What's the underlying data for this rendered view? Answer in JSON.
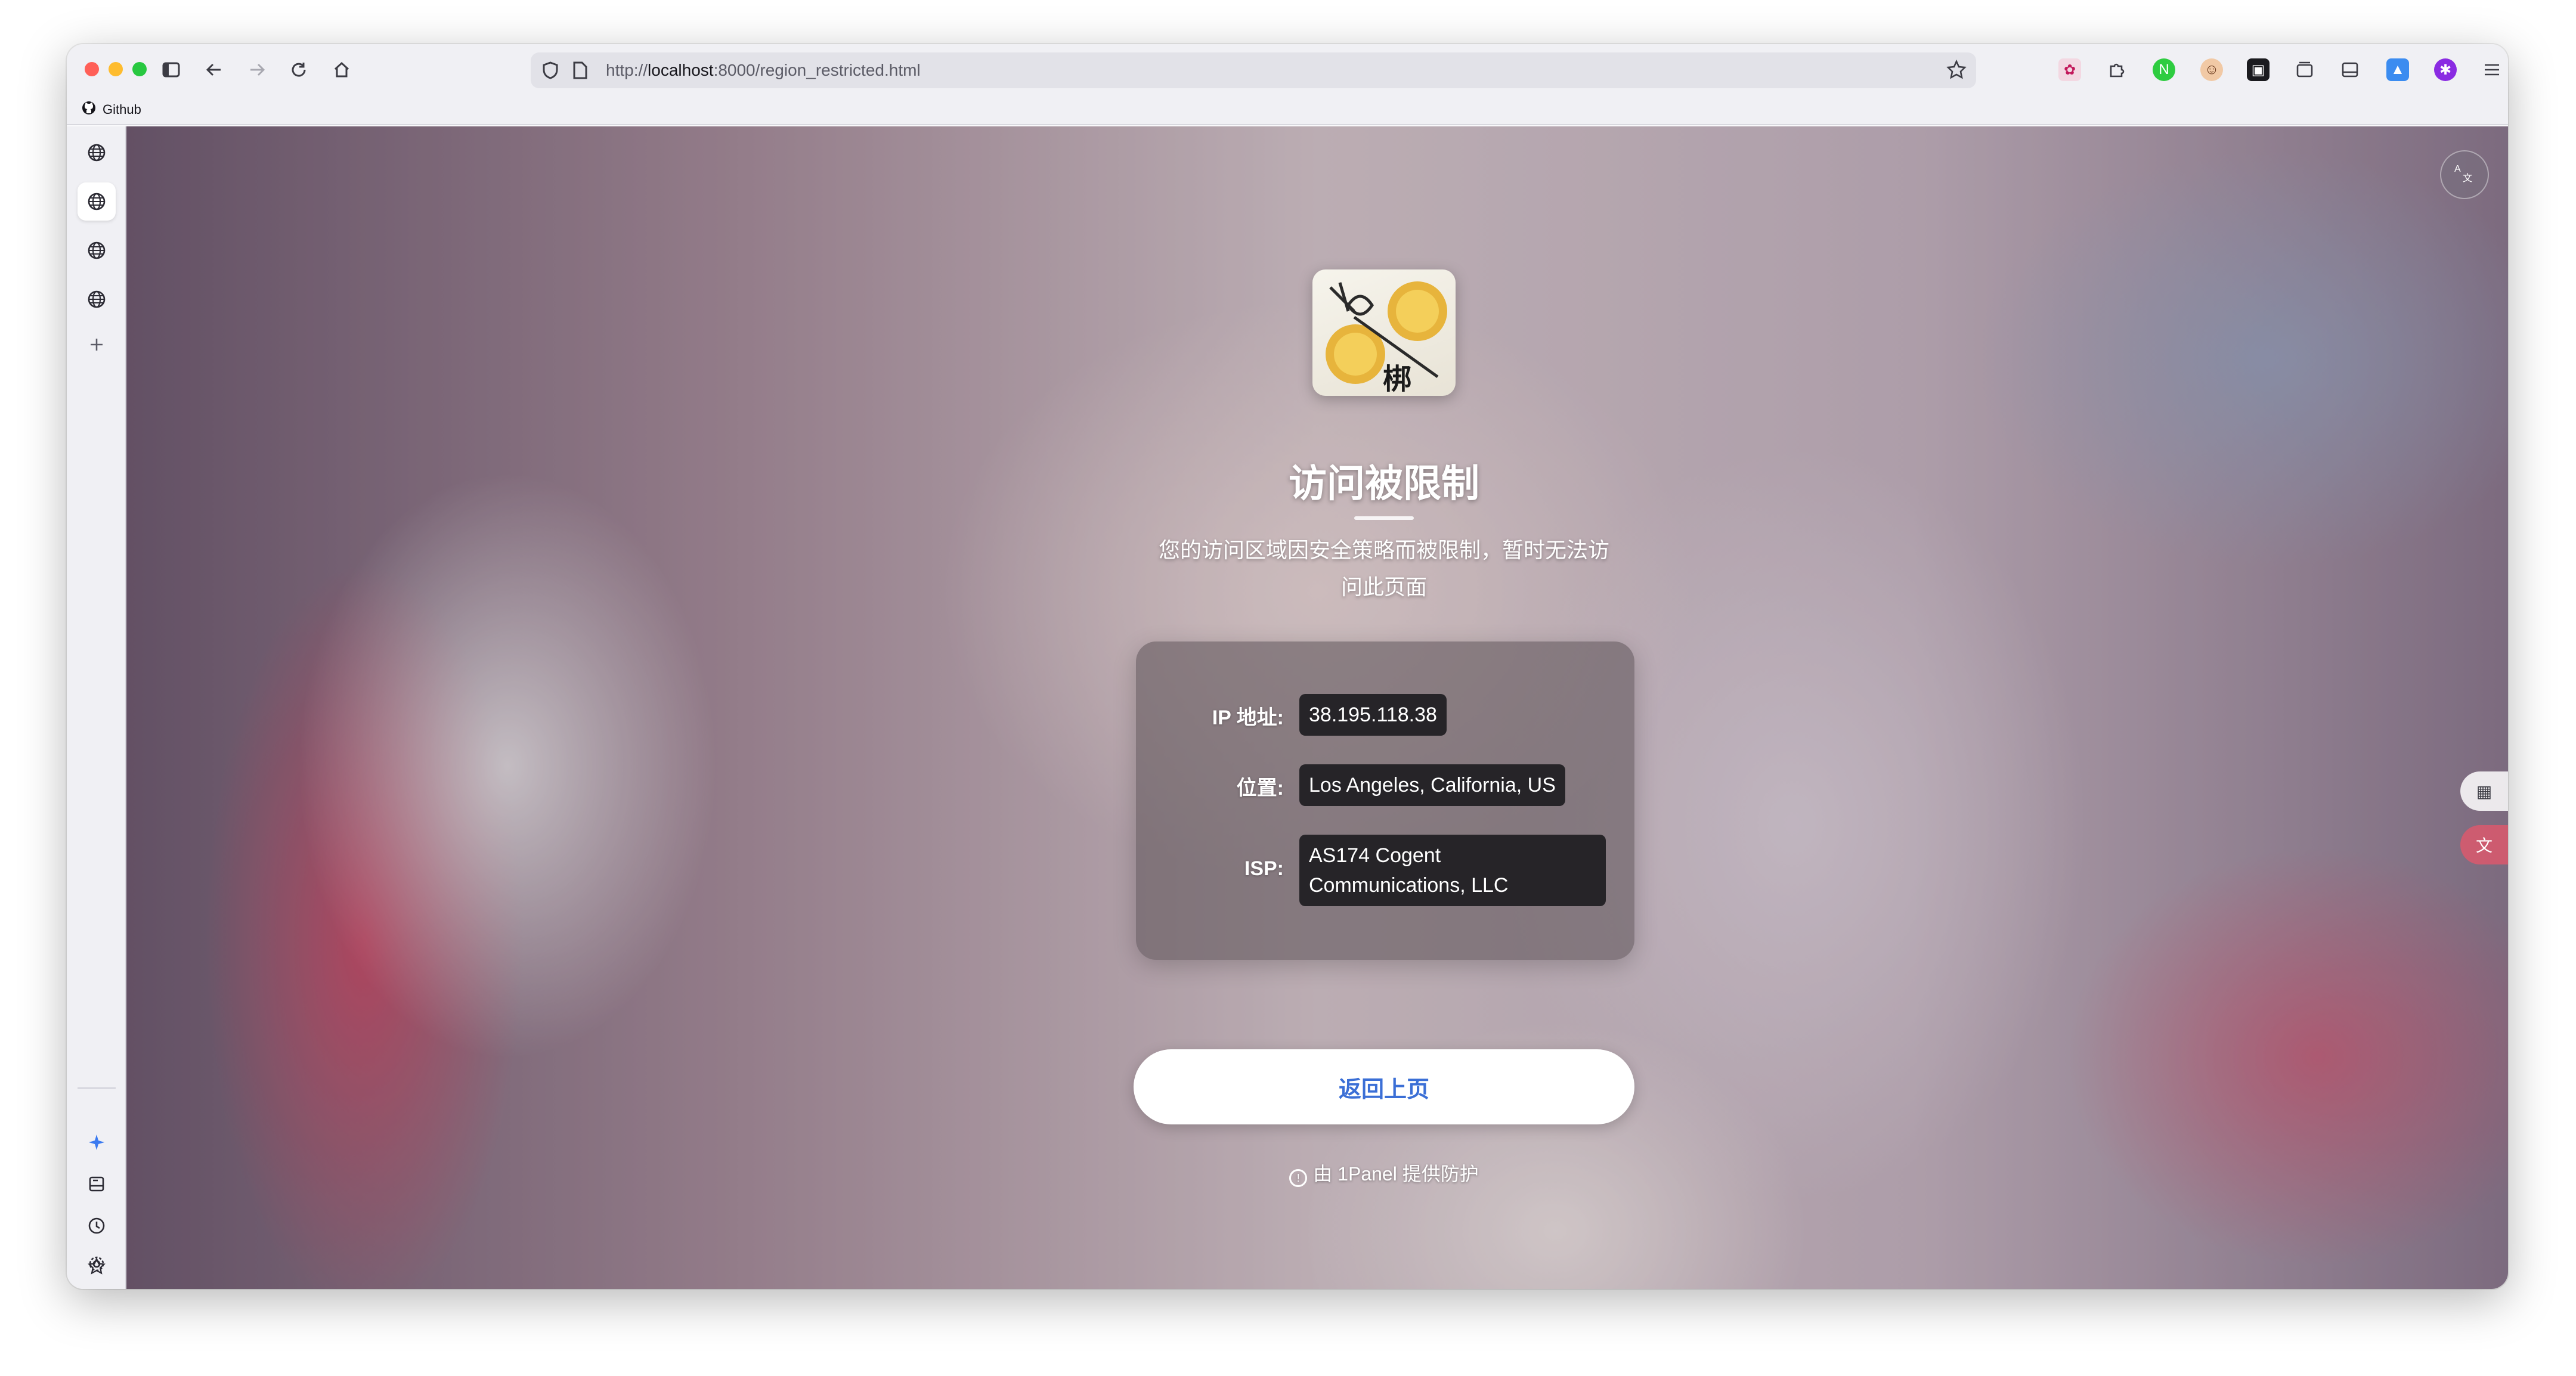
{
  "browser": {
    "url_prefix": "http://",
    "url_host": "localhost",
    "url_rest": ":8000/region_restricted.html",
    "bookmark_label": "Github",
    "nav_icons": [
      "sidebar-toggle-icon",
      "back-arrow-icon",
      "forward-arrow-icon",
      "reload-icon",
      "home-icon"
    ],
    "extension_icons": [
      "extension-1-icon",
      "puzzle-icon",
      "extension-green-icon",
      "extension-avatar-icon",
      "extension-dark-icon",
      "tabs-icon",
      "reader-icon",
      "extension-blue-icon",
      "extension-purple-icon",
      "menu-icon"
    ]
  },
  "sidebar": {
    "items": [
      "globe-icon",
      "globe-icon",
      "globe-icon",
      "globe-icon",
      "plus-icon"
    ],
    "bottom_items": [
      "sparkle-icon",
      "drive-icon",
      "history-icon",
      "star-icon",
      "settings-icon"
    ]
  },
  "page": {
    "title": "访问被限制",
    "subtitle": "您的访问区域因安全策略而被限制，暂时无法访问此页面",
    "info": [
      {
        "label": "IP 地址:",
        "value": "38.195.118.38"
      },
      {
        "label": "位置:",
        "value": "Los Angeles, California, US"
      },
      {
        "label": "ISP:",
        "value": "AS174 Cogent Communications, LLC"
      }
    ],
    "back_button": "返回上页",
    "footer": "由 1Panel 提供防护",
    "logo_text": "梆"
  },
  "colors": {
    "accent": "#3b6fd6",
    "card_bg": "#5f555a",
    "value_bg": "#262428"
  }
}
